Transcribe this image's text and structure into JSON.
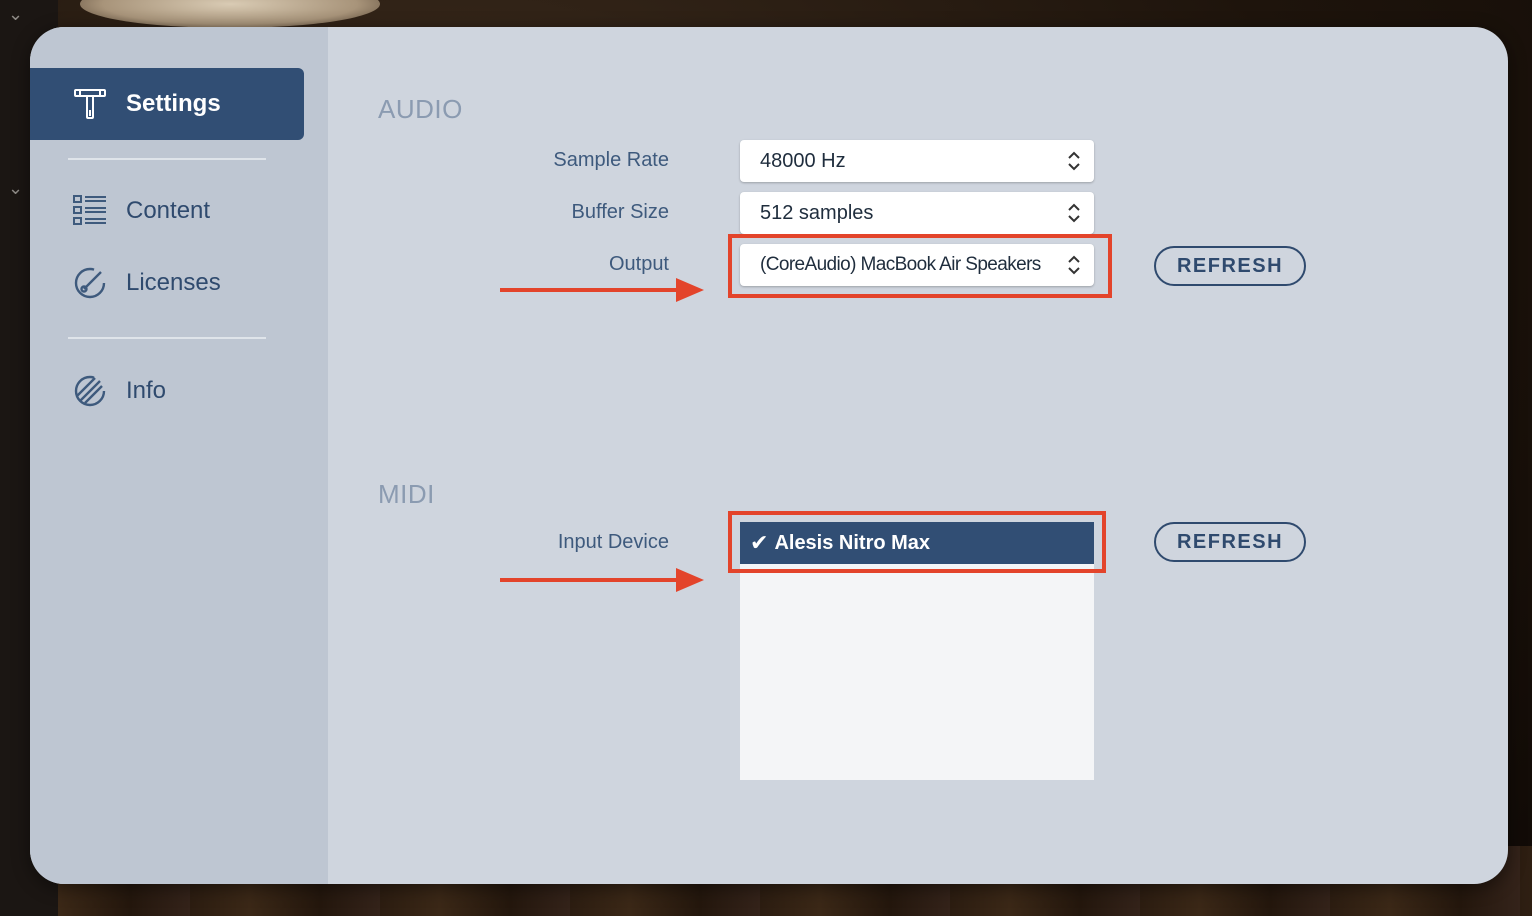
{
  "background": {
    "chevron_icon": "chevron-down-icon"
  },
  "sidebar": {
    "items": [
      {
        "label": "Settings",
        "icon": "tuning-key-icon",
        "active": true
      },
      {
        "label": "Content",
        "icon": "content-list-icon",
        "active": false
      },
      {
        "label": "Licenses",
        "icon": "license-icon",
        "active": false
      },
      {
        "label": "Info",
        "icon": "info-icon",
        "active": false
      }
    ]
  },
  "audio": {
    "title": "AUDIO",
    "sample_rate": {
      "label": "Sample Rate",
      "value": "48000 Hz"
    },
    "buffer_size": {
      "label": "Buffer Size",
      "value": "512 samples"
    },
    "output": {
      "label": "Output",
      "value": "(CoreAudio) MacBook Air Speakers"
    },
    "refresh_label": "REFRESH"
  },
  "midi": {
    "title": "MIDI",
    "input_device": {
      "label": "Input Device",
      "selected": "Alesis Nitro Max"
    },
    "refresh_label": "REFRESH"
  },
  "colors": {
    "accent": "#314e74",
    "annotation": "#e3442b",
    "panel": "#cfd5de",
    "sidebar": "#bec6d2"
  }
}
